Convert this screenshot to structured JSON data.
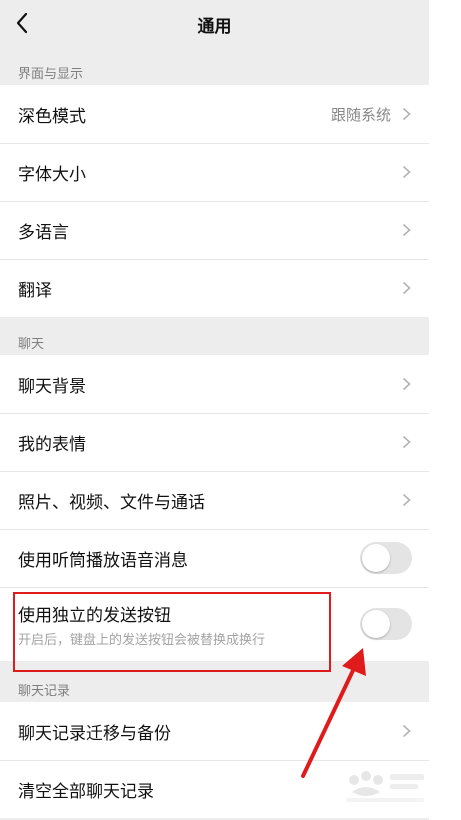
{
  "header": {
    "title": "通用"
  },
  "sections": [
    {
      "label": "界面与显示",
      "items": [
        {
          "label": "深色模式",
          "value": "跟随系统"
        },
        {
          "label": "字体大小"
        },
        {
          "label": "多语言"
        },
        {
          "label": "翻译"
        }
      ]
    },
    {
      "label": "聊天",
      "items": [
        {
          "label": "聊天背景"
        },
        {
          "label": "我的表情"
        },
        {
          "label": "照片、视频、文件与通话"
        },
        {
          "label": "使用听筒播放语音消息",
          "toggle": false
        },
        {
          "label": "使用独立的发送按钮",
          "description": "开启后，键盘上的发送按钮会被替换成换行",
          "toggle": false
        }
      ]
    },
    {
      "label": "聊天记录",
      "items": [
        {
          "label": "聊天记录迁移与备份"
        },
        {
          "label": "清空全部聊天记录"
        }
      ]
    }
  ],
  "annotation": {
    "highlight_color": "#e01b1b"
  },
  "colors": {
    "background": "#ededed",
    "toggle_off": "#e4e4e4"
  },
  "icons": {
    "back": "chevron-left-icon",
    "disclosure": "chevron-right-icon"
  }
}
